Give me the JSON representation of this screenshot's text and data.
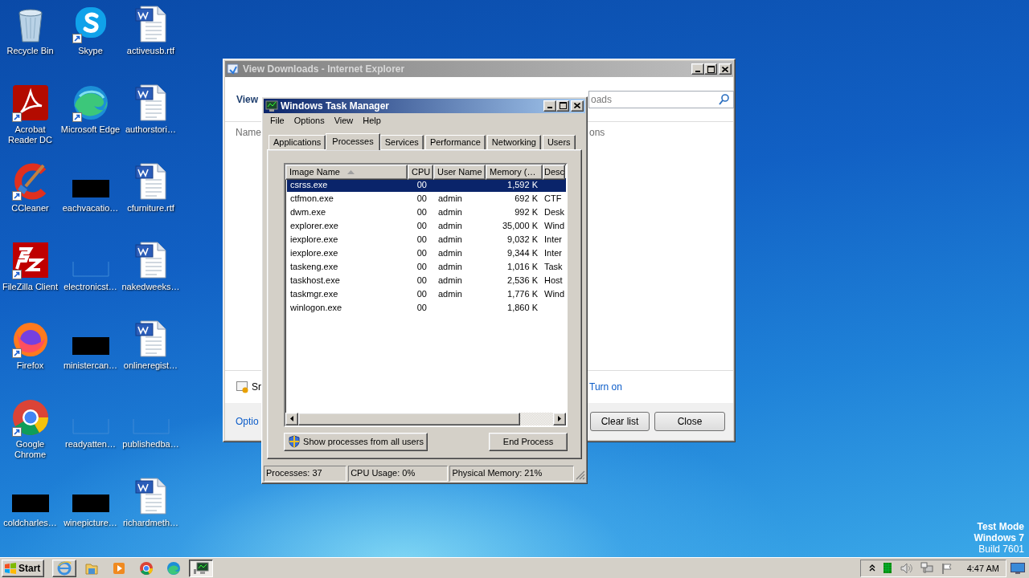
{
  "desktop_icons": [
    {
      "label": "Recycle Bin",
      "shortcut": false
    },
    {
      "label": "Skype",
      "shortcut": true
    },
    {
      "label": "activeusb.rtf",
      "shortcut": false
    },
    {
      "label": "Acrobat Reader DC",
      "shortcut": true
    },
    {
      "label": "Microsoft Edge",
      "shortcut": true
    },
    {
      "label": "authorstori…",
      "shortcut": false
    },
    {
      "label": "CCleaner",
      "shortcut": true
    },
    {
      "label": "eachvacatio…",
      "shortcut": false
    },
    {
      "label": "cfurniture.rtf",
      "shortcut": false
    },
    {
      "label": "FileZilla Client",
      "shortcut": true
    },
    {
      "label": "electronicst…",
      "shortcut": false
    },
    {
      "label": "nakedweeks…",
      "shortcut": false
    },
    {
      "label": "Firefox",
      "shortcut": true
    },
    {
      "label": "ministercan…",
      "shortcut": false
    },
    {
      "label": "onlineregist…",
      "shortcut": false
    },
    {
      "label": "Google Chrome",
      "shortcut": true
    },
    {
      "label": "readyatten…",
      "shortcut": false
    },
    {
      "label": "publishedba…",
      "shortcut": false
    },
    {
      "label": "coldcharles…",
      "shortcut": false
    },
    {
      "label": "winepicture…",
      "shortcut": false
    },
    {
      "label": "richardmeth…",
      "shortcut": false
    }
  ],
  "system_notice": [
    "Test Mode",
    "Windows 7",
    "Build 7601"
  ],
  "downloads_window": {
    "title": "View Downloads - Internet Explorer",
    "heading": "View",
    "search": {
      "placeholder": "oads"
    },
    "columns": [
      "Name",
      "ons"
    ],
    "notice": "Sr",
    "notice_link": "Turn on",
    "options_link": "Optio",
    "buttons": [
      "Clear list",
      "Close"
    ]
  },
  "task_manager": {
    "title": "Windows Task Manager",
    "menu": [
      "File",
      "Options",
      "View",
      "Help"
    ],
    "tabs": [
      {
        "label": "Applications",
        "selected": false
      },
      {
        "label": "Processes",
        "selected": true
      },
      {
        "label": "Services",
        "selected": false
      },
      {
        "label": "Performance",
        "selected": false
      },
      {
        "label": "Networking",
        "selected": false
      },
      {
        "label": "Users",
        "selected": false
      }
    ],
    "table": {
      "columns": [
        {
          "label": "Image Name",
          "sorted": true
        },
        {
          "label": "CPU",
          "sorted": false
        },
        {
          "label": "User Name",
          "sorted": false
        },
        {
          "label": "Memory (…",
          "sorted": false
        },
        {
          "label": "Desc",
          "sorted": false
        }
      ],
      "rows": [
        {
          "image_name": "csrss.exe",
          "cpu": "00",
          "memory": "1,592 K",
          "selected": true
        },
        {
          "image_name": "ctfmon.exe",
          "cpu": "00",
          "user_name": "admin",
          "memory": "692 K",
          "description": "CTF",
          "selected": false
        },
        {
          "image_name": "dwm.exe",
          "cpu": "00",
          "user_name": "admin",
          "memory": "992 K",
          "description": "Desk",
          "selected": false
        },
        {
          "image_name": "explorer.exe",
          "cpu": "00",
          "user_name": "admin",
          "memory": "35,000 K",
          "description": "Wind",
          "selected": false
        },
        {
          "image_name": "iexplore.exe",
          "cpu": "00",
          "user_name": "admin",
          "memory": "9,032 K",
          "description": "Inter",
          "selected": false
        },
        {
          "image_name": "iexplore.exe",
          "cpu": "00",
          "user_name": "admin",
          "memory": "9,344 K",
          "description": "Inter",
          "selected": false
        },
        {
          "image_name": "taskeng.exe",
          "cpu": "00",
          "user_name": "admin",
          "memory": "1,016 K",
          "description": "Task",
          "selected": false
        },
        {
          "image_name": "taskhost.exe",
          "cpu": "00",
          "user_name": "admin",
          "memory": "2,536 K",
          "description": "Host",
          "selected": false
        },
        {
          "image_name": "taskmgr.exe",
          "cpu": "00",
          "user_name": "admin",
          "memory": "1,776 K",
          "description": "Wind",
          "selected": false
        },
        {
          "image_name": "winlogon.exe",
          "cpu": "00",
          "memory": "1,860 K",
          "selected": false
        }
      ]
    },
    "buttons": [
      "Show processes from all users",
      "End Process"
    ],
    "status_bar": [
      "Processes: 37",
      "CPU Usage: 0%",
      "Physical Memory: 21%"
    ]
  },
  "taskbar": {
    "start": "Start",
    "clock": "4:47 AM"
  }
}
